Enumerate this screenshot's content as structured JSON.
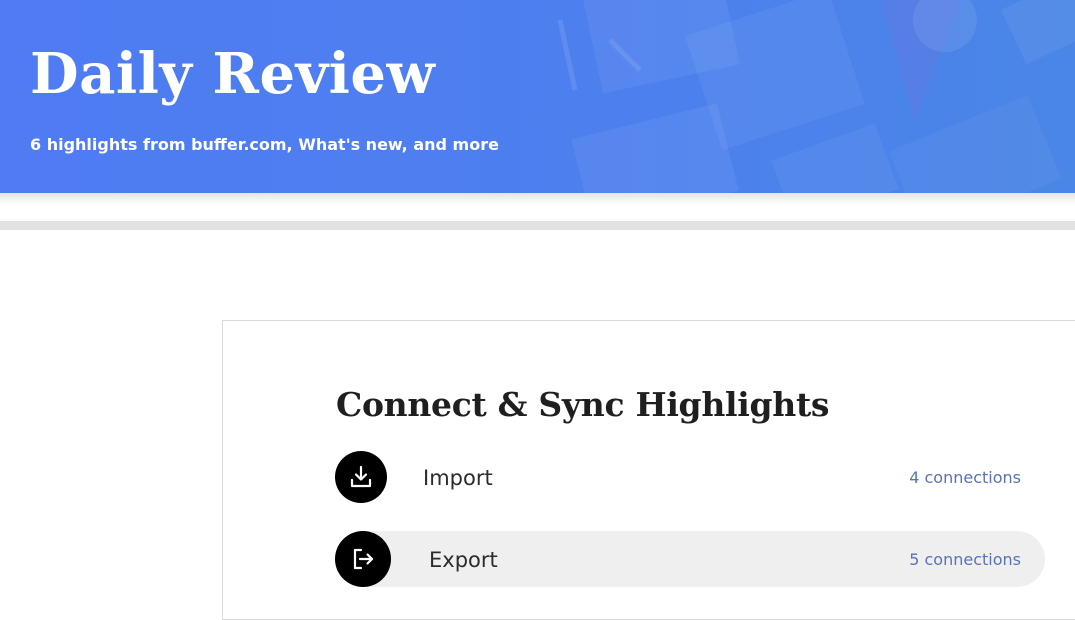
{
  "banner": {
    "title": "Daily Review",
    "subtitle": "6 highlights from buffer.com, What's new, and more",
    "background_color": "#4f7cf3"
  },
  "sync": {
    "title": "Connect & Sync Highlights",
    "items": [
      {
        "label": "Import",
        "count": "4 connections",
        "icon": "download-icon"
      },
      {
        "label": "Export",
        "count": "5 connections",
        "icon": "export-icon"
      }
    ]
  },
  "colors": {
    "link": "#5a72b6",
    "icon_circle": "#000000",
    "active_row": "#efefef"
  }
}
